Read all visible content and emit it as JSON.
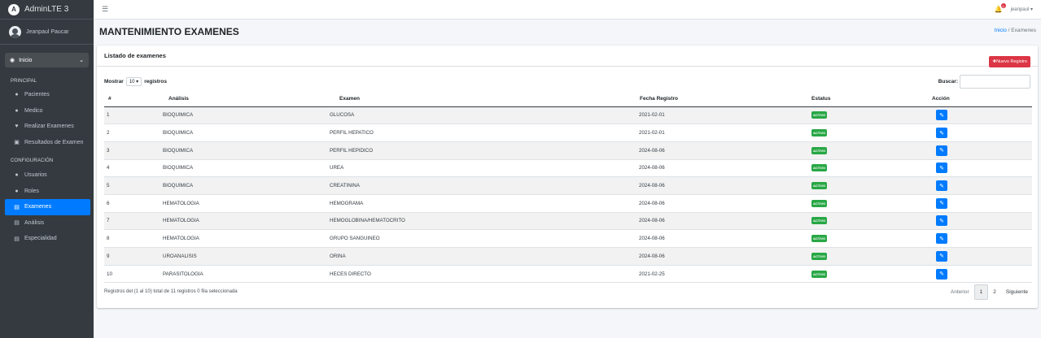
{
  "brand": {
    "name": "AdminLTE 3",
    "logo_letter": "A"
  },
  "user": {
    "name": "Jeanpaul Paucar"
  },
  "topbar": {
    "menu_icon": "bars-icon",
    "notif_count": "4",
    "username": "jeanpaul ▾"
  },
  "sidebar": {
    "inicio": "Inicio",
    "section_principal": "PRINCIPAL",
    "section_config": "CONFIGURACIÓN",
    "items": [
      {
        "label": "Pacientes",
        "icon": "user-icon"
      },
      {
        "label": "Medico",
        "icon": "user-icon"
      },
      {
        "label": "Realizar Examenes",
        "icon": "heart-icon"
      },
      {
        "label": "Resultados de Examen",
        "icon": "id-card-icon"
      },
      {
        "label": "Usuarios",
        "icon": "users-icon"
      },
      {
        "label": "Roles",
        "icon": "user-icon"
      },
      {
        "label": "Examenes",
        "icon": "clipboard-icon"
      },
      {
        "label": "Análisis",
        "icon": "file-icon"
      },
      {
        "label": "Especialidad",
        "icon": "file-icon"
      }
    ]
  },
  "page": {
    "title": "MANTENIMIENTO EXAMENES",
    "breadcrumb_home": "Inicio",
    "breadcrumb_sep": "/",
    "breadcrumb_current": "Examenes"
  },
  "card": {
    "title": "Listado de examenes",
    "new_button": "Nuevo Registro",
    "show_label": "Mostrar",
    "show_value": "10 ▾",
    "records_label": "registros",
    "search_label": "Buscar:"
  },
  "table": {
    "headers": [
      "#",
      "Análisis",
      "Examen",
      "Fecha Registro",
      "Estatus",
      "Acción"
    ],
    "rows": [
      [
        "1",
        "BIOQUIMICA",
        "GLUCOSA",
        "2021-02-01",
        "ACTIVO"
      ],
      [
        "2",
        "BIOQUIMICA",
        "PERFIL HEPATICO",
        "2021-02-01",
        "ACTIVO"
      ],
      [
        "3",
        "BIOQUIMICA",
        "PERFIL HEPIDICO",
        "2024-08-06",
        "ACTIVO"
      ],
      [
        "4",
        "BIOQUIMICA",
        "UREA",
        "2024-08-06",
        "ACTIVO"
      ],
      [
        "5",
        "BIOQUIMICA",
        "CREATININA",
        "2024-08-06",
        "ACTIVO"
      ],
      [
        "6",
        "HEMATOLOGIA",
        "HEMOGRAMA",
        "2024-08-06",
        "ACTIVO"
      ],
      [
        "7",
        "HEMATOLOGIA",
        "HEMOGLOBINA/HEMATOCRITO",
        "2024-08-06",
        "ACTIVO"
      ],
      [
        "8",
        "HEMATOLOGIA",
        "GRUPO SANGUINEO",
        "2024-08-06",
        "ACTIVO"
      ],
      [
        "9",
        "UROANALISIS",
        "ORINA",
        "2024-08-06",
        "ACTIVO"
      ],
      [
        "10",
        "PARASITOLOGIA",
        "HECES DIRECTO",
        "2021-02-25",
        "ACTIVO"
      ]
    ]
  },
  "footer": {
    "info": "Registros del (1 al 10) total de 11 registros     0 fila seleccionada",
    "prev": "Anterior",
    "pages": [
      "1",
      "2"
    ],
    "next": "Siguiente"
  },
  "colors": {
    "sidebar": "#343a40",
    "primary": "#007bff",
    "danger": "#dc3545",
    "success": "#28a745"
  }
}
